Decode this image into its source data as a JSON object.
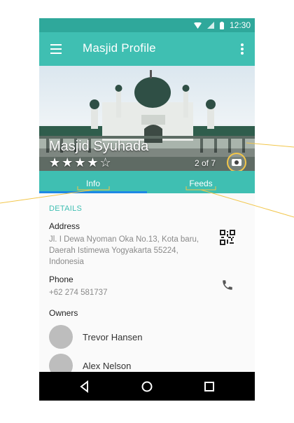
{
  "status_bar": {
    "time": "12:30"
  },
  "app_bar": {
    "title": "Masjid Profile"
  },
  "hero": {
    "name": "Masjid Syuhada",
    "rating": 4,
    "rating_max": 5,
    "stars_text": "★★★★☆",
    "photo_counter": "2 of 7"
  },
  "tabs": [
    {
      "label": "Info",
      "selected": true
    },
    {
      "label": "Feeds",
      "selected": false
    }
  ],
  "details": {
    "section_title": "DETAILS",
    "address_label": "Address",
    "address_value": "Jl. I Dewa Nyoman Oka No.13, Kota baru, Daerah Istimewa Yogyakarta 55224, Indonesia",
    "phone_label": "Phone",
    "phone_value": "+62 274 581737",
    "owners_label": "Owners"
  },
  "owners": [
    {
      "name": "Trevor Hansen"
    },
    {
      "name": "Alex Nelson"
    }
  ],
  "colors": {
    "status_bar": "#2fa89b",
    "primary": "#3fbfb2",
    "accent": "#1e88e5",
    "callout": "#f2c64a"
  },
  "icons": [
    "wifi-icon",
    "signal-icon",
    "battery-icon",
    "menu-icon",
    "more-vert-icon",
    "camera-icon",
    "qr-code-icon",
    "phone-icon",
    "back-icon",
    "home-icon",
    "recents-icon"
  ]
}
